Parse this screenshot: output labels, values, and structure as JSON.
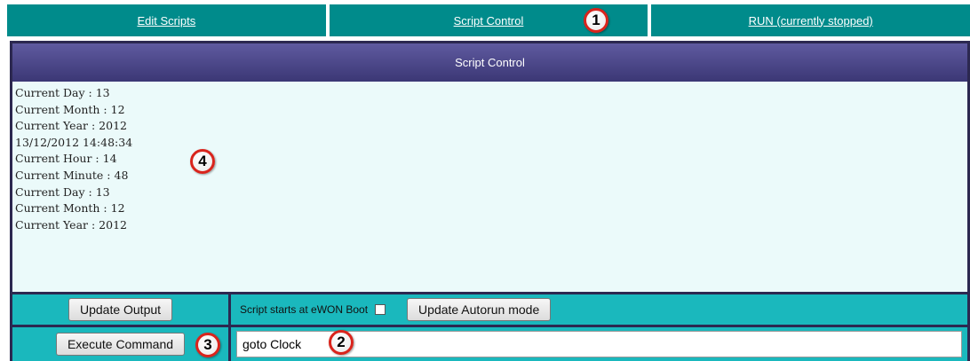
{
  "nav": {
    "tabs": [
      {
        "label": "Edit Scripts"
      },
      {
        "label": "Script Control"
      },
      {
        "label": "RUN (currently stopped)"
      }
    ]
  },
  "panel": {
    "title": "Script Control",
    "output_lines": [
      "Current Day : 13",
      "Current Month : 12",
      "Current Year : 2012",
      "13/12/2012 14:48:34",
      "Current Hour : 14",
      "Current Minute : 48",
      "Current Day : 13",
      "Current Month : 12",
      "Current Year : 2012"
    ]
  },
  "controls": {
    "update_output_label": "Update Output",
    "boot_label": "Script starts at eWON Boot",
    "boot_checked": false,
    "update_autorun_label": "Update Autorun mode",
    "execute_label": "Execute Command",
    "command_value": "goto Clock"
  },
  "callouts": [
    "1",
    "2",
    "3",
    "4"
  ],
  "colors": {
    "nav_bg": "#008b8b",
    "panel_header": "#3b3775",
    "output_bg": "#ebfafa",
    "control_row_bg": "#1ab8bd",
    "callout_border": "#d9241c"
  }
}
